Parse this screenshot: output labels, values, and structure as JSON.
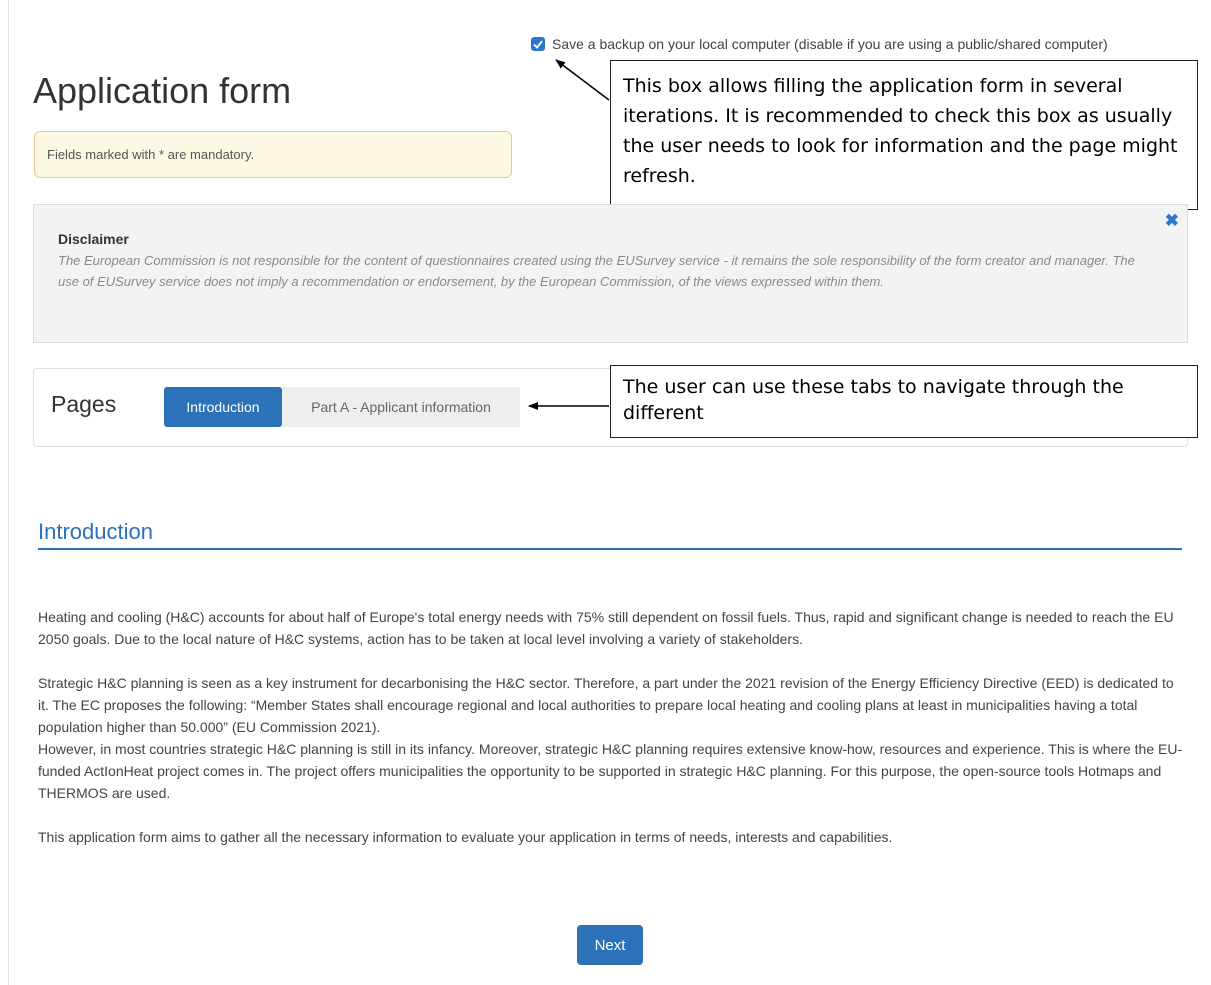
{
  "backup": {
    "checked": true,
    "label": "Save a backup on your local computer (disable if you are using a public/shared computer)"
  },
  "page_title": "Application form",
  "mandatory_notice": "Fields marked with * are mandatory.",
  "callouts": {
    "backup_note": "This box allows filling the application form in several iterations. It is recommended to check this box as usually the user needs to look for information and the page might refresh.",
    "tabs_note": "The user can use these tabs to navigate through the different"
  },
  "disclaimer": {
    "title": "Disclaimer",
    "text": "The European Commission is not responsible for the content of questionnaires created using the EUSurvey service - it remains the sole responsibility of the form creator and manager. The use of EUSurvey service does not imply a recommendation or endorsement, by the European Commission, of the views expressed within them.",
    "close_glyph": "✖"
  },
  "pages": {
    "label": "Pages",
    "tabs": [
      {
        "label": "Introduction",
        "active": true
      },
      {
        "label": "Part A - Applicant information",
        "active": false
      }
    ]
  },
  "section": {
    "heading": "Introduction",
    "paragraphs": [
      "Heating and cooling (H&C) accounts for about half of Europe's total energy needs with 75% still dependent on fossil fuels. Thus, rapid and significant change is needed to reach the EU 2050 goals. Due to the local nature of H&C systems, action has to be taken at local level involving a variety of stakeholders.",
      "Strategic H&C planning is seen as a key instrument for decarbonising the H&C sector. Therefore, a part under the 2021 revision of the Energy Efficiency Directive (EED) is dedicated to it. The EC proposes the following: “Member States shall encourage regional and local authorities to prepare local heating and cooling plans at least in municipalities having a total population higher than 50.000” (EU Commission 2021).",
      "However, in most countries strategic H&C planning is still in its infancy. Moreover, strategic H&C planning requires extensive know-how, resources and experience. This is where the EU-funded ActIonHeat project comes in. The project offers municipalities the opportunity to be supported in strategic H&C planning. For this purpose, the open-source tools Hotmaps and THERMOS are used.",
      "This application form aims to gather all the necessary information to evaluate your application in terms of needs, interests and capabilities."
    ]
  },
  "next_button": "Next",
  "colors": {
    "accent": "#2b72b8",
    "notice_bg": "#fcf8e3",
    "notice_border": "#e6c79a",
    "disclaimer_bg": "#f3f3f3"
  }
}
